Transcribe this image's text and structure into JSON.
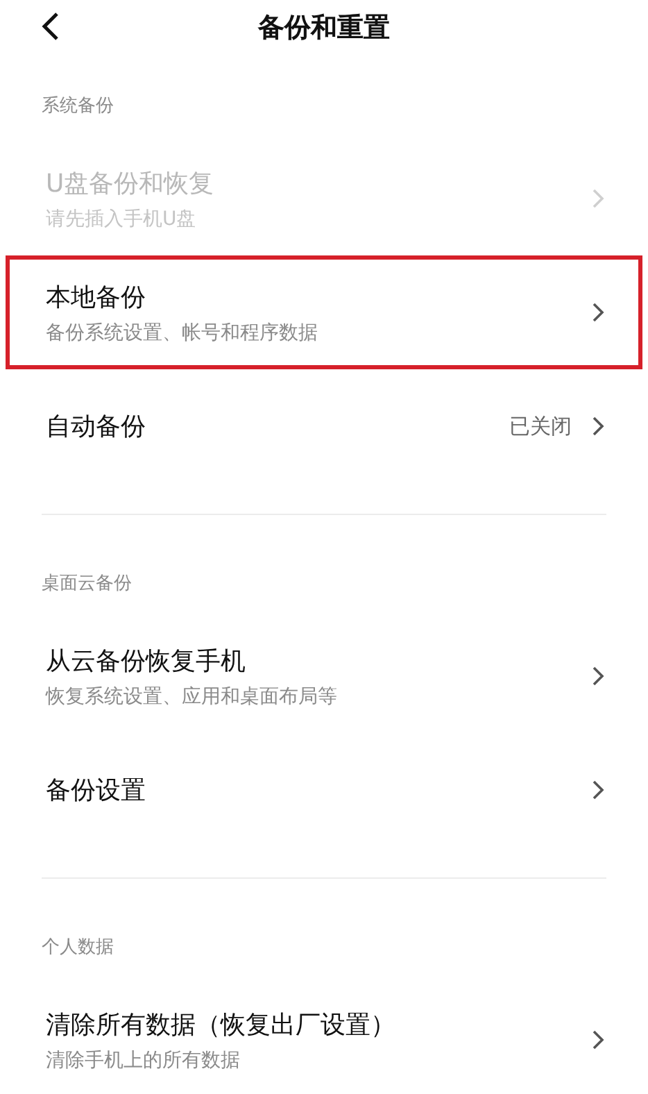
{
  "header": {
    "title": "备份和重置"
  },
  "sections": [
    {
      "label": "系统备份",
      "items": [
        {
          "title": "U盘备份和恢复",
          "subtitle": "请先插入手机U盘",
          "disabled": true,
          "highlighted": false
        },
        {
          "title": "本地备份",
          "subtitle": "备份系统设置、帐号和程序数据",
          "disabled": false,
          "highlighted": true
        },
        {
          "title": "自动备份",
          "value": "已关闭",
          "disabled": false,
          "highlighted": false
        }
      ]
    },
    {
      "label": "桌面云备份",
      "items": [
        {
          "title": "从云备份恢复手机",
          "subtitle": "恢复系统设置、应用和桌面布局等",
          "disabled": false,
          "highlighted": false
        },
        {
          "title": "备份设置",
          "disabled": false,
          "highlighted": false
        }
      ]
    },
    {
      "label": "个人数据",
      "items": [
        {
          "title": "清除所有数据（恢复出厂设置）",
          "subtitle": "清除手机上的所有数据",
          "disabled": false,
          "highlighted": false
        }
      ]
    }
  ]
}
